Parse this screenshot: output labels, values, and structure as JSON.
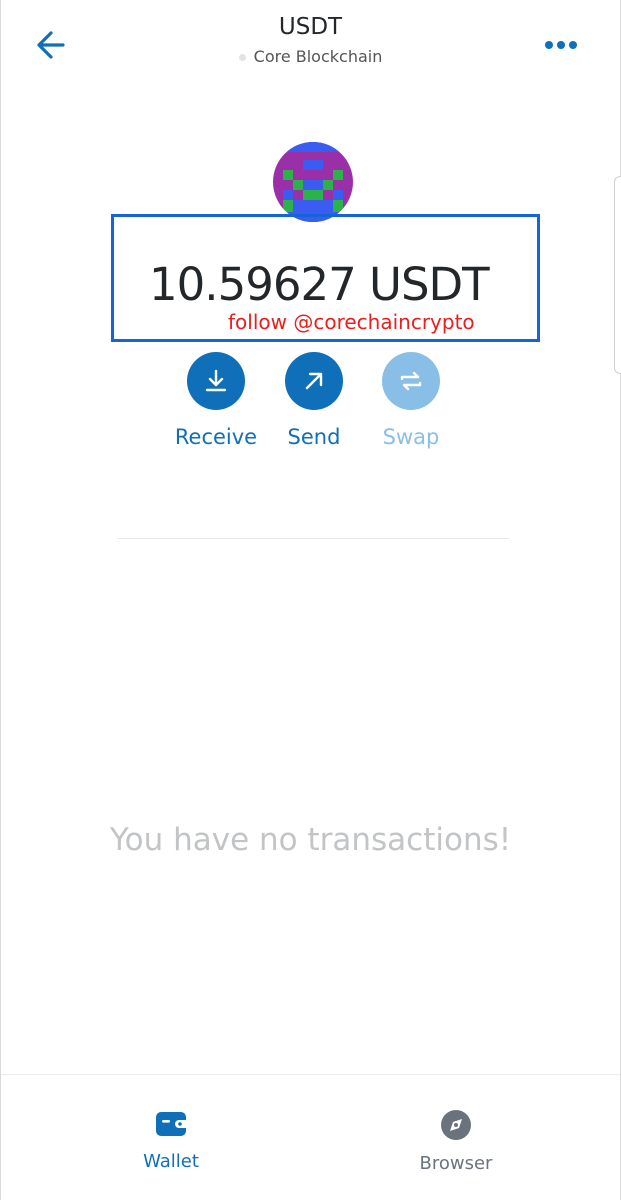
{
  "header": {
    "title": "USDT",
    "network": "Core Blockchain"
  },
  "balance": {
    "amount": "10.59627 USDT",
    "watermark": "follow @corechaincrypto"
  },
  "actions": [
    {
      "label": "Receive",
      "icon": "download-icon",
      "enabled": true
    },
    {
      "label": "Send",
      "icon": "arrow-up-right-icon",
      "enabled": true
    },
    {
      "label": "Swap",
      "icon": "swap-arrows-icon",
      "enabled": false
    }
  ],
  "transactions": {
    "empty_message": "You have no transactions!"
  },
  "bottom_nav": {
    "items": [
      {
        "label": "Wallet",
        "icon": "wallet-icon",
        "active": true
      },
      {
        "label": "Browser",
        "icon": "compass-icon",
        "active": false
      }
    ]
  },
  "colors": {
    "accent": "#0f6fb8",
    "accent_disabled": "#89bfe7",
    "highlight_box": "#1565d8",
    "watermark": "#e8201d"
  }
}
